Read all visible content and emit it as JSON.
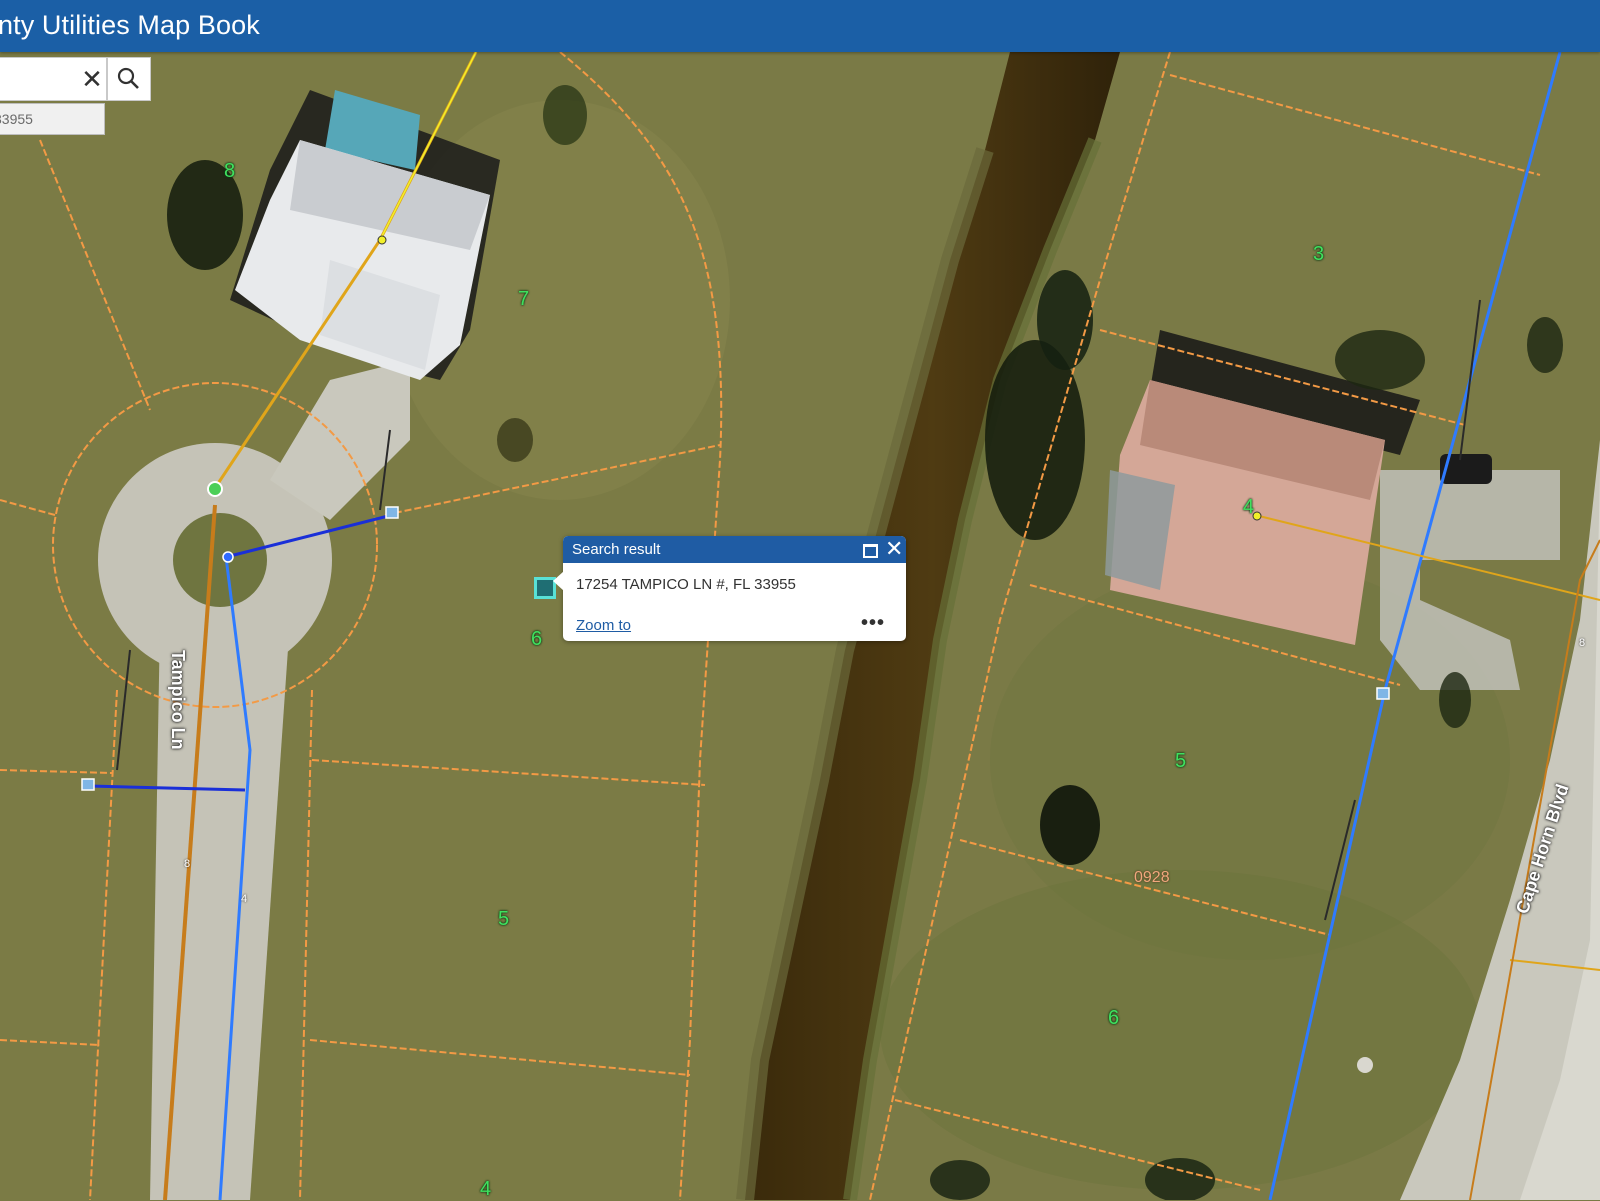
{
  "header": {
    "title": "nty Utilities Map Book"
  },
  "search": {
    "clear_symbol": "✕",
    "suggestion": "33955"
  },
  "popup": {
    "title": "Search result",
    "address": "17254 TAMPICO LN #, FL 33955",
    "zoom_label": "Zoom to",
    "more_label": "•••",
    "close_symbol": "✕"
  },
  "map": {
    "streets": [
      "Tampico Ln",
      "Cape Horn Blvd"
    ],
    "parcel_numbers": [
      "8",
      "7",
      "6",
      "5",
      "4",
      "3",
      "4",
      "5",
      "6"
    ],
    "lot_label": "0928",
    "pipe_labels": [
      "8",
      "4",
      "8"
    ]
  },
  "colors": {
    "header": "#1b5fa6",
    "parcel_line": "#f39a45",
    "water_main": "#2f7bff",
    "service_line": "#1a2fd8",
    "gas_line": "#e0a51a",
    "sewer_line": "#c77c1b",
    "parcel_number": "#3fe05e",
    "popup_header": "#1f5ca4"
  }
}
